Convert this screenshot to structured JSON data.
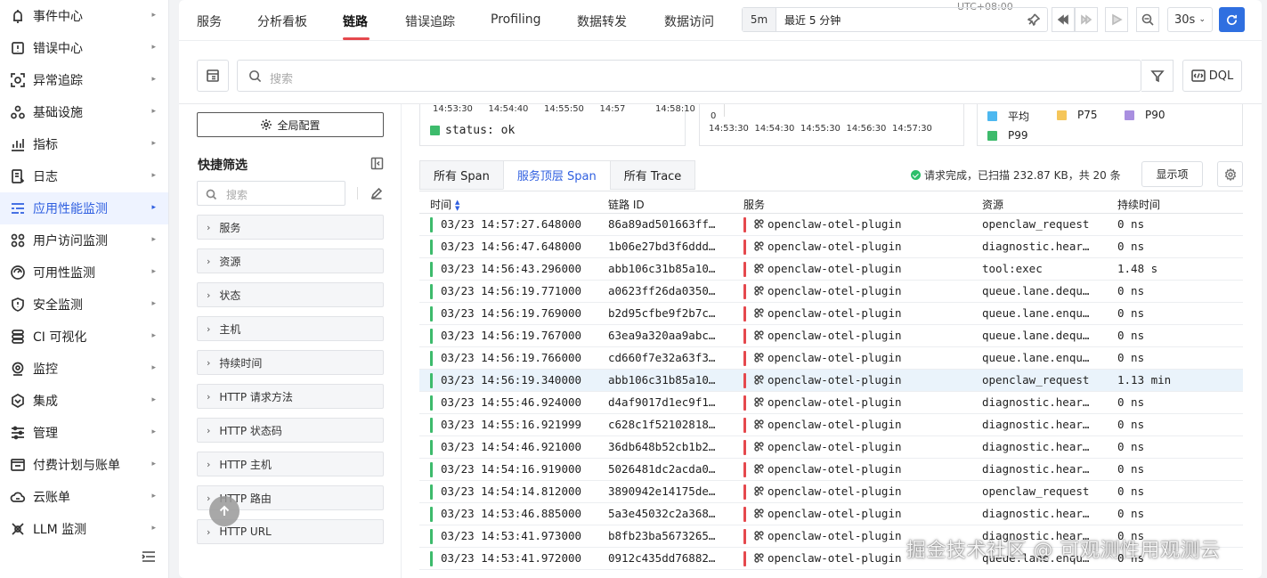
{
  "sidebar": {
    "items": [
      {
        "label": "事件中心",
        "icon": "bell-icon"
      },
      {
        "label": "错误中心",
        "icon": "bug-icon"
      },
      {
        "label": "异常追踪",
        "icon": "target-icon"
      },
      {
        "label": "基础设施",
        "icon": "cluster-icon"
      },
      {
        "label": "指标",
        "icon": "metrics-icon"
      },
      {
        "label": "日志",
        "icon": "log-icon"
      },
      {
        "label": "应用性能监测",
        "icon": "apm-icon",
        "active": true
      },
      {
        "label": "用户访问监测",
        "icon": "grid-icon"
      },
      {
        "label": "可用性监测",
        "icon": "shield-check-icon"
      },
      {
        "label": "安全监测",
        "icon": "security-icon"
      },
      {
        "label": "CI 可视化",
        "icon": "ci-icon"
      },
      {
        "label": "监控",
        "icon": "monitor-icon"
      },
      {
        "label": "集成",
        "icon": "integration-icon"
      },
      {
        "label": "管理",
        "icon": "settings-sliders-icon"
      },
      {
        "label": "付费计划与账单",
        "icon": "billing-icon"
      },
      {
        "label": "云账单",
        "icon": "cloud-icon"
      },
      {
        "label": "LLM 监测",
        "icon": "llm-icon"
      }
    ]
  },
  "header": {
    "tabs": [
      "服务",
      "分析看板",
      "链路",
      "错误追踪",
      "Profiling",
      "数据转发",
      "数据访问"
    ],
    "active_tab": "链路",
    "timezone": "UTC+08:00",
    "time_preset": "5m",
    "time_range": "最近 5 分钟",
    "refresh_interval": "30s"
  },
  "search": {
    "placeholder": "搜索",
    "dql_label": "DQL"
  },
  "filters": {
    "global_config_label": "全局配置",
    "title": "快捷筛选",
    "search_placeholder": "搜索",
    "facets": [
      "服务",
      "资源",
      "状态",
      "主机",
      "持续时间",
      "HTTP 请求方法",
      "HTTP 状态码",
      "HTTP 主机",
      "HTTP 路由",
      "HTTP URL"
    ]
  },
  "charts": {
    "status_chart": {
      "x_ticks": [
        "14:53:30",
        "14:54:40",
        "14:55:50",
        "14:57",
        "14:58:10"
      ],
      "legend": "status: ok",
      "color": "#3dbb6c"
    },
    "count_chart": {
      "y_tick": "0",
      "x_ticks": [
        "14:53:30",
        "14:54:30",
        "14:55:30",
        "14:56:30",
        "14:57:30"
      ]
    },
    "duration_legend": [
      {
        "label": "平均",
        "color": "#4db8f0"
      },
      {
        "label": "P75",
        "color": "#f5c65a"
      },
      {
        "label": "P90",
        "color": "#a98fe0"
      },
      {
        "label": "P99",
        "color": "#3dbb6c"
      }
    ]
  },
  "subtabs": [
    "所有 Span",
    "服务顶层 Span",
    "所有 Trace"
  ],
  "active_subtab": "服务顶层 Span",
  "request_status": "请求完成，已扫描 232.87 KB，共 20 条",
  "display_button": "显示项",
  "table": {
    "columns": [
      "时间",
      "链路 ID",
      "服务",
      "资源",
      "持续时间"
    ],
    "rows": [
      {
        "time": "03/23 14:57:27.648000",
        "trace_id": "86a89ad501663ff…",
        "service": "openclaw-otel-plugin",
        "resource": "openclaw_request",
        "duration": "0 ns"
      },
      {
        "time": "03/23 14:56:47.648000",
        "trace_id": "1b06e27bd3f6ddd…",
        "service": "openclaw-otel-plugin",
        "resource": "diagnostic.hear…",
        "duration": "0 ns"
      },
      {
        "time": "03/23 14:56:43.296000",
        "trace_id": "abb106c31b85a10…",
        "service": "openclaw-otel-plugin",
        "resource": "tool:exec",
        "duration": "1.48 s"
      },
      {
        "time": "03/23 14:56:19.771000",
        "trace_id": "a0623ff26da0350…",
        "service": "openclaw-otel-plugin",
        "resource": "queue.lane.dequ…",
        "duration": "0 ns"
      },
      {
        "time": "03/23 14:56:19.769000",
        "trace_id": "b2d95cfbe9f2b7c…",
        "service": "openclaw-otel-plugin",
        "resource": "queue.lane.enqu…",
        "duration": "0 ns"
      },
      {
        "time": "03/23 14:56:19.767000",
        "trace_id": "63ea9a320aa9abc…",
        "service": "openclaw-otel-plugin",
        "resource": "queue.lane.dequ…",
        "duration": "0 ns"
      },
      {
        "time": "03/23 14:56:19.766000",
        "trace_id": "cd660f7e32a63f3…",
        "service": "openclaw-otel-plugin",
        "resource": "queue.lane.enqu…",
        "duration": "0 ns"
      },
      {
        "time": "03/23 14:56:19.340000",
        "trace_id": "abb106c31b85a10…",
        "service": "openclaw-otel-plugin",
        "resource": "openclaw_request",
        "duration": "1.13 min",
        "selected": true
      },
      {
        "time": "03/23 14:55:46.924000",
        "trace_id": "d4af9017d1ec9f1…",
        "service": "openclaw-otel-plugin",
        "resource": "diagnostic.hear…",
        "duration": "0 ns"
      },
      {
        "time": "03/23 14:55:16.921999",
        "trace_id": "c628c1f52102818…",
        "service": "openclaw-otel-plugin",
        "resource": "diagnostic.hear…",
        "duration": "0 ns"
      },
      {
        "time": "03/23 14:54:46.921000",
        "trace_id": "36db648b52cb1b2…",
        "service": "openclaw-otel-plugin",
        "resource": "diagnostic.hear…",
        "duration": "0 ns"
      },
      {
        "time": "03/23 14:54:16.919000",
        "trace_id": "5026481dc2acda0…",
        "service": "openclaw-otel-plugin",
        "resource": "diagnostic.hear…",
        "duration": "0 ns"
      },
      {
        "time": "03/23 14:54:14.812000",
        "trace_id": "3890942e14175de…",
        "service": "openclaw-otel-plugin",
        "resource": "openclaw_request",
        "duration": "0 ns"
      },
      {
        "time": "03/23 14:53:46.885000",
        "trace_id": "5a3e45032c2a368…",
        "service": "openclaw-otel-plugin",
        "resource": "diagnostic.hear…",
        "duration": "0 ns"
      },
      {
        "time": "03/23 14:53:41.973000",
        "trace_id": "b8fb23ba5673265…",
        "service": "openclaw-otel-plugin",
        "resource": "diagnostic.hear…",
        "duration": "0 ns"
      },
      {
        "time": "03/23 14:53:41.972000",
        "trace_id": "0912c435dd76882…",
        "service": "openclaw-otel-plugin",
        "resource": "queue.lane.enqu…",
        "duration": "0 ns"
      }
    ]
  },
  "colors": {
    "accent": "#2f5fe0",
    "status_ok": "#3dbb6c",
    "service_marker": "#e5484d"
  },
  "watermark": "掘金技术社区 @ 可观测性用观测云"
}
